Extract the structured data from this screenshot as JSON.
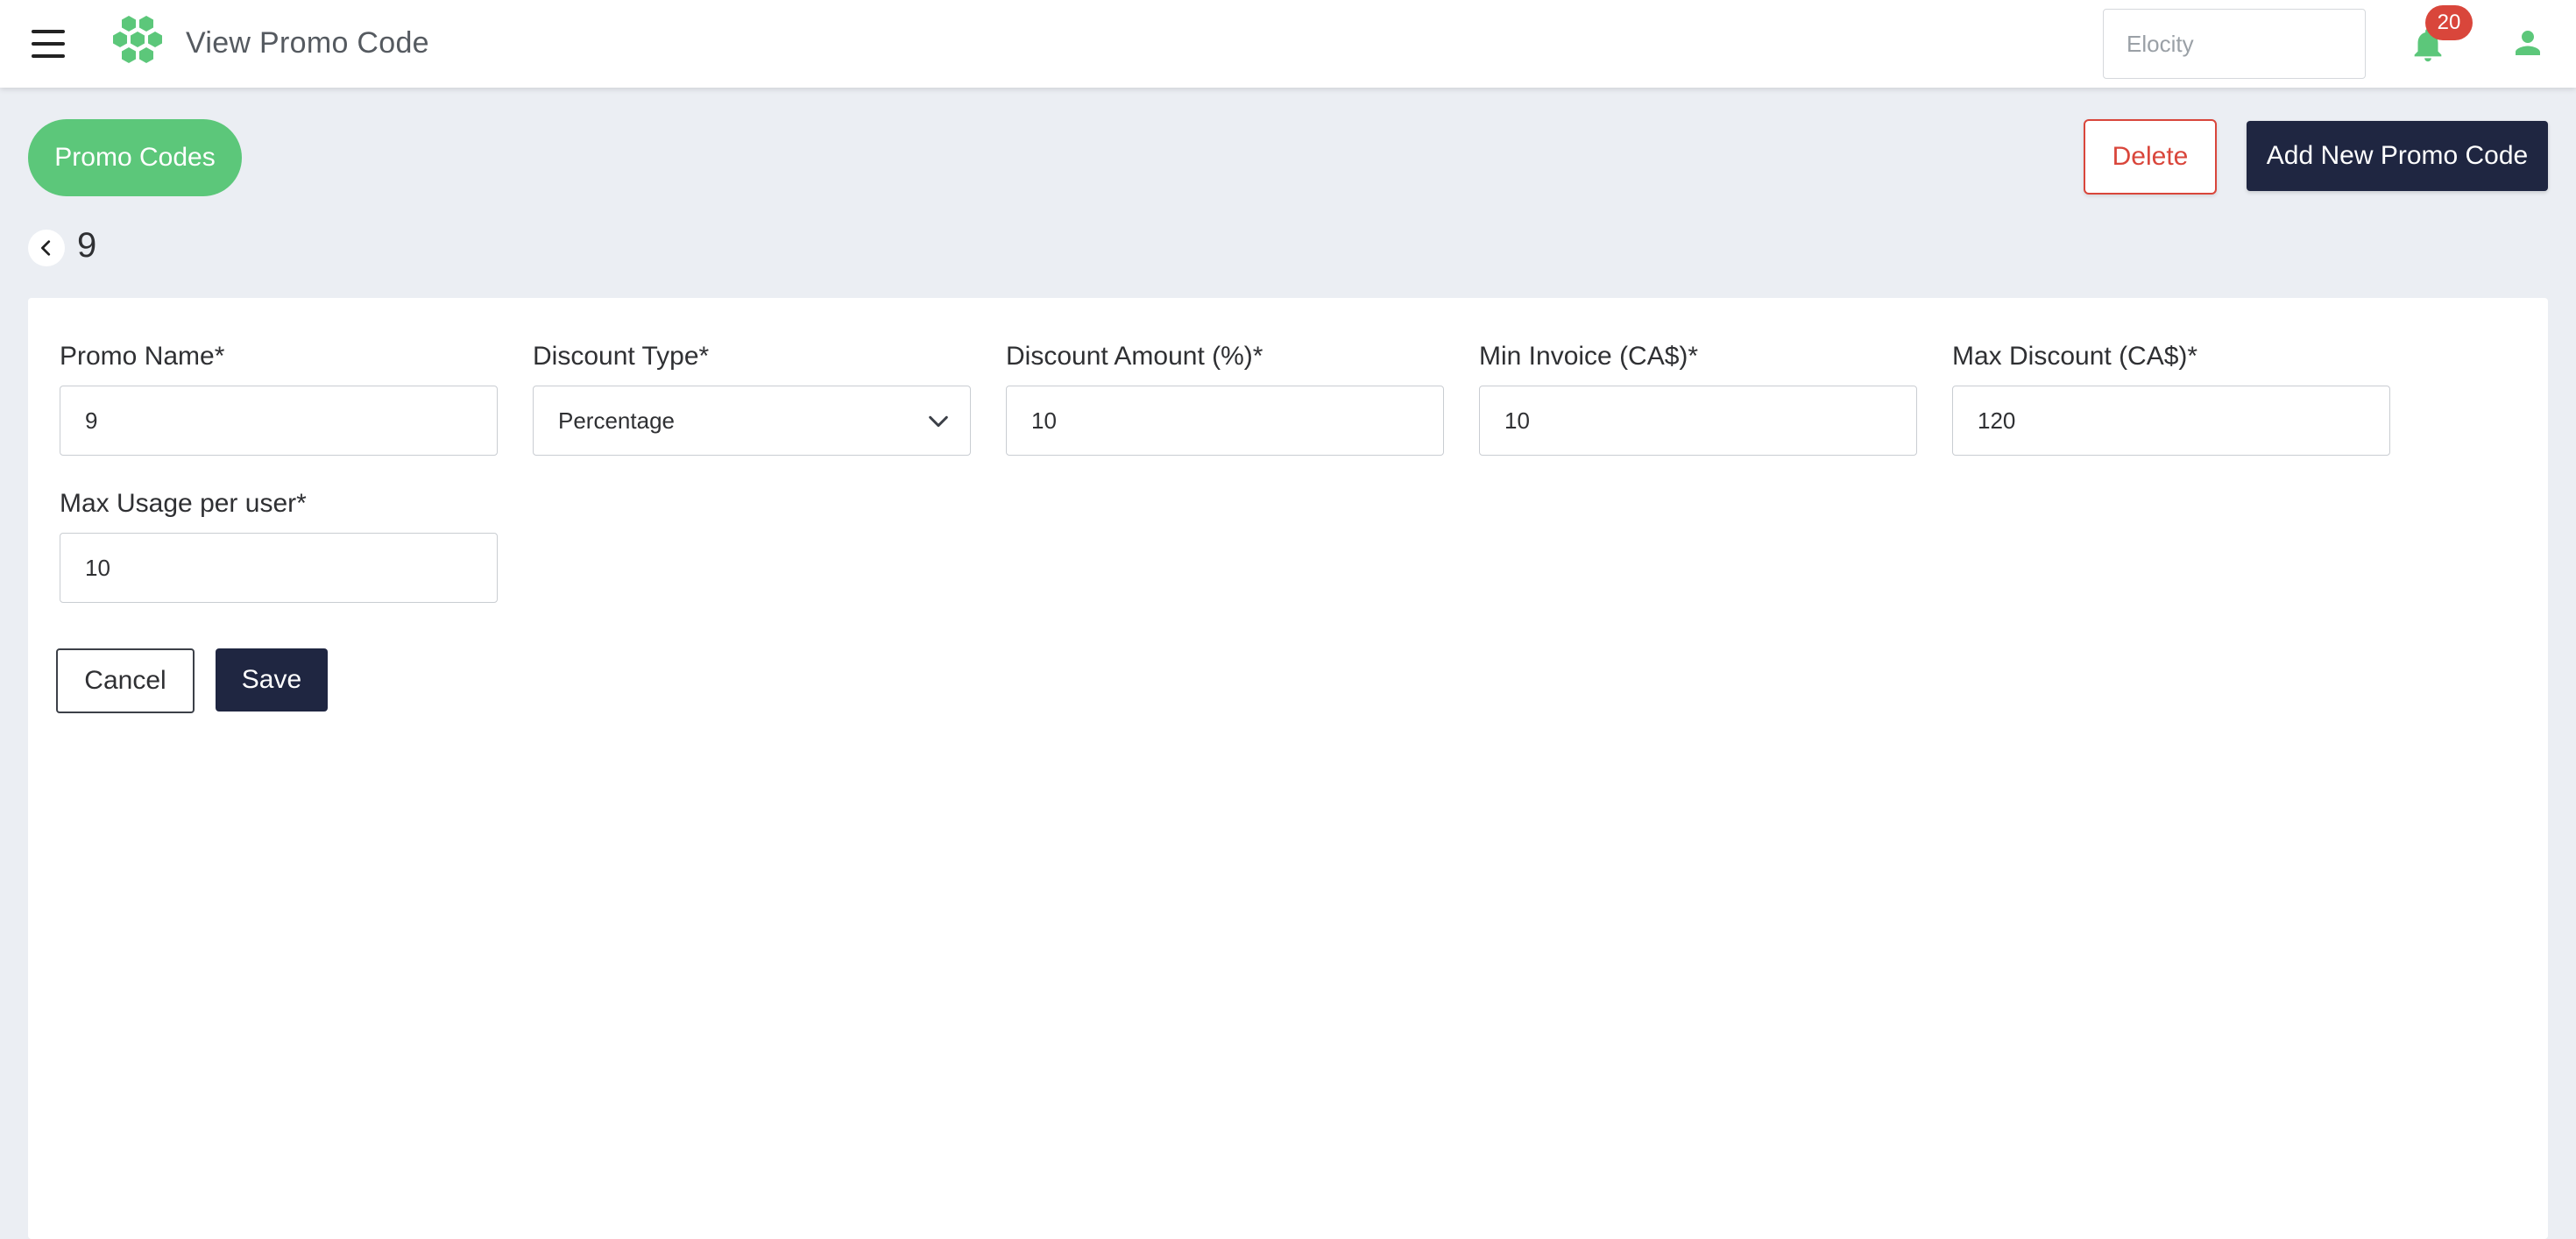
{
  "header": {
    "title": "View Promo Code",
    "search_placeholder": "Elocity",
    "notification_count": "20"
  },
  "toolbar": {
    "section_label": "Promo Codes",
    "delete_label": "Delete",
    "add_label": "Add New Promo Code"
  },
  "record": {
    "title": "9"
  },
  "form": {
    "promo_name": {
      "label": "Promo Name*",
      "value": "9"
    },
    "discount_type": {
      "label": "Discount Type*",
      "value": "Percentage"
    },
    "discount_amount": {
      "label": "Discount Amount (%)*",
      "value": "10"
    },
    "min_invoice": {
      "label": "Min Invoice (CA$)*",
      "value": "10"
    },
    "max_discount": {
      "label": "Max Discount (CA$)*",
      "value": "120"
    },
    "max_usage": {
      "label": "Max Usage per user*",
      "value": "10"
    },
    "cancel_label": "Cancel",
    "save_label": "Save"
  },
  "colors": {
    "brand_green": "#5cc77a",
    "navy": "#1f2641",
    "danger": "#d9463b",
    "background": "#ebeef3"
  },
  "icons": [
    "menu-icon",
    "app-logo",
    "bell-icon",
    "user-icon",
    "chevron-left-icon",
    "chevron-down-icon"
  ]
}
